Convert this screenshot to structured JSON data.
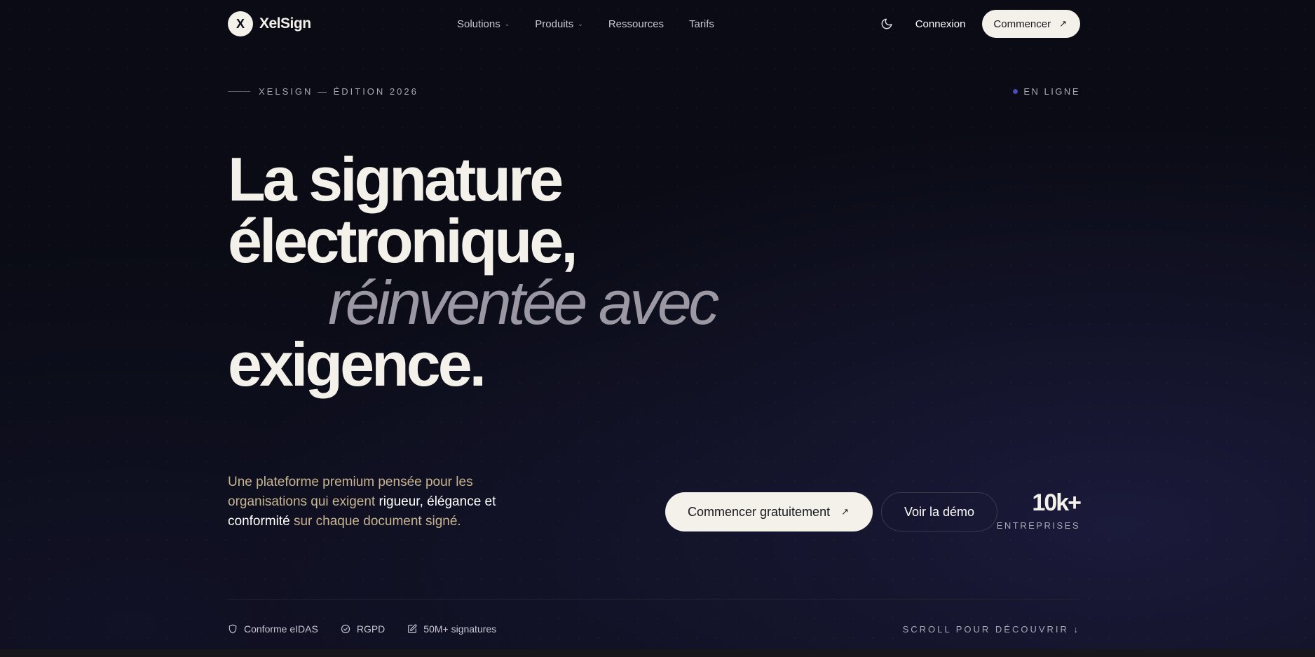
{
  "nav": {
    "logo_mark": "X",
    "logo_text": "XelSign",
    "menu": [
      {
        "label": "Solutions",
        "dropdown": true
      },
      {
        "label": "Produits",
        "dropdown": true
      },
      {
        "label": "Ressources",
        "dropdown": false
      },
      {
        "label": "Tarifs",
        "dropdown": false
      }
    ],
    "theme_icon": "moon-icon",
    "login_label": "Connexion",
    "start_label": "Commencer",
    "start_arrow": "↗"
  },
  "edition": {
    "text": "XELSIGN — ÉDITION 2026",
    "status": "EN LIGNE"
  },
  "headline": {
    "line1": "La signature",
    "line2": "électronique,",
    "line3": "réinventée avec",
    "line4": "exigence."
  },
  "description": {
    "part1": "Une plateforme premium pensée pour les organisations qui exigent ",
    "highlight1": "rigueur, élégance et conformité",
    "part2": " sur chaque document signé."
  },
  "cta": {
    "primary_label": "Commencer gratuitement",
    "primary_arrow": "↗",
    "secondary_label": "Voir la démo"
  },
  "stat": {
    "value": "10k+",
    "label": "ENTREPRISES"
  },
  "badges": [
    {
      "icon": "shield-icon",
      "label": "Conforme eIDAS"
    },
    {
      "icon": "check-circle-icon",
      "label": "RGPD"
    },
    {
      "icon": "edit-document-icon",
      "label": "50M+ signatures"
    }
  ],
  "scroll_label": "SCROLL POUR DÉCOUVRIR ↓",
  "colors": {
    "background": "#0a0b14",
    "cream": "#f4f1ea",
    "gold_text": "#c8b590",
    "accent_dot": "#4a4ab8"
  }
}
